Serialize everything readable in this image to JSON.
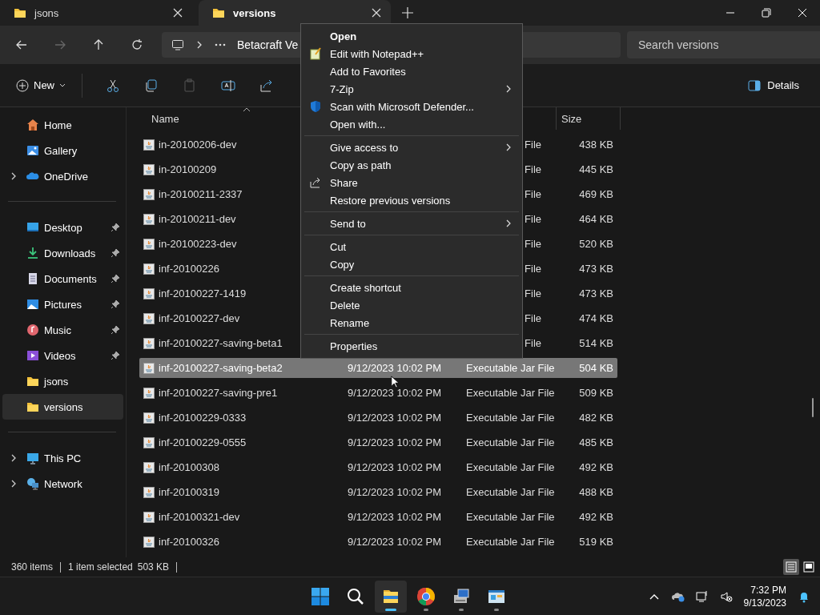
{
  "tabs": [
    {
      "label": "jsons",
      "selected": false
    },
    {
      "label": "versions",
      "selected": true
    }
  ],
  "address": {
    "breadcrumb": "Betacraft Ve",
    "search_placeholder": "Search versions"
  },
  "toolbar": {
    "new_label": "New",
    "details_label": "Details"
  },
  "sidebar": {
    "groups": [
      [
        {
          "label": "Home",
          "expandable": false,
          "pinned": false,
          "selected": false
        },
        {
          "label": "Gallery",
          "expandable": false,
          "pinned": false,
          "selected": false
        },
        {
          "label": "OneDrive",
          "expandable": true,
          "pinned": false,
          "selected": false
        }
      ],
      [
        {
          "label": "Desktop",
          "expandable": false,
          "pinned": true,
          "selected": false
        },
        {
          "label": "Downloads",
          "expandable": false,
          "pinned": true,
          "selected": false
        },
        {
          "label": "Documents",
          "expandable": false,
          "pinned": true,
          "selected": false
        },
        {
          "label": "Pictures",
          "expandable": false,
          "pinned": true,
          "selected": false
        },
        {
          "label": "Music",
          "expandable": false,
          "pinned": true,
          "selected": false
        },
        {
          "label": "Videos",
          "expandable": false,
          "pinned": true,
          "selected": false
        },
        {
          "label": "jsons",
          "expandable": false,
          "pinned": false,
          "selected": false
        },
        {
          "label": "versions",
          "expandable": false,
          "pinned": false,
          "selected": true
        }
      ],
      [
        {
          "label": "This PC",
          "expandable": true,
          "pinned": false,
          "selected": false
        },
        {
          "label": "Network",
          "expandable": true,
          "pinned": false,
          "selected": false
        }
      ]
    ]
  },
  "columns": [
    {
      "label": "Name",
      "sorted": true
    },
    {
      "label": "Size",
      "sorted": false
    }
  ],
  "rows": [
    {
      "name": "in-20100206-dev",
      "type": "File",
      "size": "438 KB",
      "selected": false
    },
    {
      "name": "in-20100209",
      "type": "File",
      "size": "445 KB",
      "selected": false
    },
    {
      "name": "in-20100211-2337",
      "type": "File",
      "size": "469 KB",
      "selected": false
    },
    {
      "name": "in-20100211-dev",
      "type": "File",
      "size": "464 KB",
      "selected": false
    },
    {
      "name": "in-20100223-dev",
      "type": "File",
      "size": "520 KB",
      "selected": false
    },
    {
      "name": "inf-20100226",
      "type": "File",
      "size": "473 KB",
      "selected": false
    },
    {
      "name": "inf-20100227-1419",
      "type": "File",
      "size": "473 KB",
      "selected": false
    },
    {
      "name": "inf-20100227-dev",
      "type": "File",
      "size": "474 KB",
      "selected": false
    },
    {
      "name": "inf-20100227-saving-beta1",
      "type": "File",
      "size": "514 KB",
      "selected": false
    },
    {
      "name": "inf-20100227-saving-beta2",
      "date": "9/12/2023 10:02 PM",
      "type": "Executable Jar File",
      "size": "504 KB",
      "selected": true
    },
    {
      "name": "inf-20100227-saving-pre1",
      "date": "9/12/2023 10:02 PM",
      "type": "Executable Jar File",
      "size": "509 KB",
      "selected": false
    },
    {
      "name": "inf-20100229-0333",
      "date": "9/12/2023 10:02 PM",
      "type": "Executable Jar File",
      "size": "482 KB",
      "selected": false
    },
    {
      "name": "inf-20100229-0555",
      "date": "9/12/2023 10:02 PM",
      "type": "Executable Jar File",
      "size": "485 KB",
      "selected": false
    },
    {
      "name": "inf-20100308",
      "date": "9/12/2023 10:02 PM",
      "type": "Executable Jar File",
      "size": "492 KB",
      "selected": false
    },
    {
      "name": "inf-20100319",
      "date": "9/12/2023 10:02 PM",
      "type": "Executable Jar File",
      "size": "488 KB",
      "selected": false
    },
    {
      "name": "inf-20100321-dev",
      "date": "9/12/2023 10:02 PM",
      "type": "Executable Jar File",
      "size": "492 KB",
      "selected": false
    },
    {
      "name": "inf-20100326",
      "date": "9/12/2023 10:02 PM",
      "type": "Executable Jar File",
      "size": "519 KB",
      "selected": false
    }
  ],
  "context_menu": {
    "groups": [
      [
        {
          "label": "Open",
          "default": true,
          "submenu": false
        },
        {
          "label": "Edit with Notepad++",
          "default": false,
          "submenu": false
        },
        {
          "label": "Add to Favorites",
          "default": false,
          "submenu": false
        },
        {
          "label": "7-Zip",
          "default": false,
          "submenu": true
        },
        {
          "label": "Scan with Microsoft Defender...",
          "default": false,
          "submenu": false
        },
        {
          "label": "Open with...",
          "default": false,
          "submenu": false
        }
      ],
      [
        {
          "label": "Give access to",
          "default": false,
          "submenu": true
        },
        {
          "label": "Copy as path",
          "default": false,
          "submenu": false
        },
        {
          "label": "Share",
          "default": false,
          "submenu": false
        },
        {
          "label": "Restore previous versions",
          "default": false,
          "submenu": false
        }
      ],
      [
        {
          "label": "Send to",
          "default": false,
          "submenu": true
        }
      ],
      [
        {
          "label": "Cut",
          "default": false,
          "submenu": false
        },
        {
          "label": "Copy",
          "default": false,
          "submenu": false
        }
      ],
      [
        {
          "label": "Create shortcut",
          "default": false,
          "submenu": false
        },
        {
          "label": "Delete",
          "default": false,
          "submenu": false
        },
        {
          "label": "Rename",
          "default": false,
          "submenu": false
        }
      ],
      [
        {
          "label": "Properties",
          "default": false,
          "submenu": false
        }
      ]
    ]
  },
  "status_bar": {
    "item_count": "360 items",
    "selection": "1 item selected",
    "selection_size": "503 KB",
    "views": [
      {
        "selected": true
      },
      {
        "selected": false
      }
    ]
  },
  "taskbar": {
    "apps": [
      {
        "running": true,
        "active": true
      },
      {
        "running": true,
        "active": false
      },
      {
        "running": true,
        "active": false
      },
      {
        "running": true,
        "active": false
      }
    ],
    "time": "7:32 PM",
    "date": "9/13/2023"
  }
}
